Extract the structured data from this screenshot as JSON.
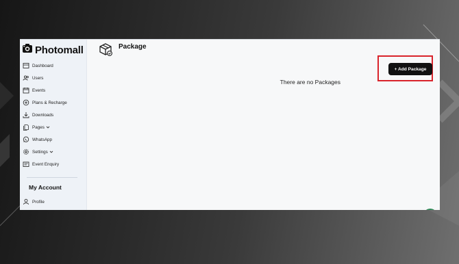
{
  "brand": {
    "name": "Photomall"
  },
  "sidebar": {
    "items": [
      {
        "label": "Dashboard",
        "icon": "dashboard-icon"
      },
      {
        "label": "Users",
        "icon": "users-icon"
      },
      {
        "label": "Events",
        "icon": "calendar-icon"
      },
      {
        "label": "Plans & Recharge",
        "icon": "plans-icon"
      },
      {
        "label": "Downloads",
        "icon": "download-icon"
      },
      {
        "label": "Pages",
        "icon": "pages-icon",
        "has_dropdown": true
      },
      {
        "label": "WhatsApp",
        "icon": "whatsapp-icon"
      },
      {
        "label": "Settings",
        "icon": "gear-icon",
        "has_dropdown": true
      },
      {
        "label": "Event Enquiry",
        "icon": "enquiry-icon"
      }
    ],
    "account_title": "My Account",
    "account_items": [
      {
        "label": "Profile",
        "icon": "profile-icon"
      }
    ]
  },
  "main": {
    "title": "Package",
    "title_icon": "package-icon",
    "add_button_label": "+ Add Package",
    "empty_message": "There are no Packages"
  },
  "colors": {
    "accent_button": "#111111",
    "highlight_border": "#d9222a",
    "sidebar_bg": "#eef2f7",
    "fab": "#2e8b57"
  }
}
